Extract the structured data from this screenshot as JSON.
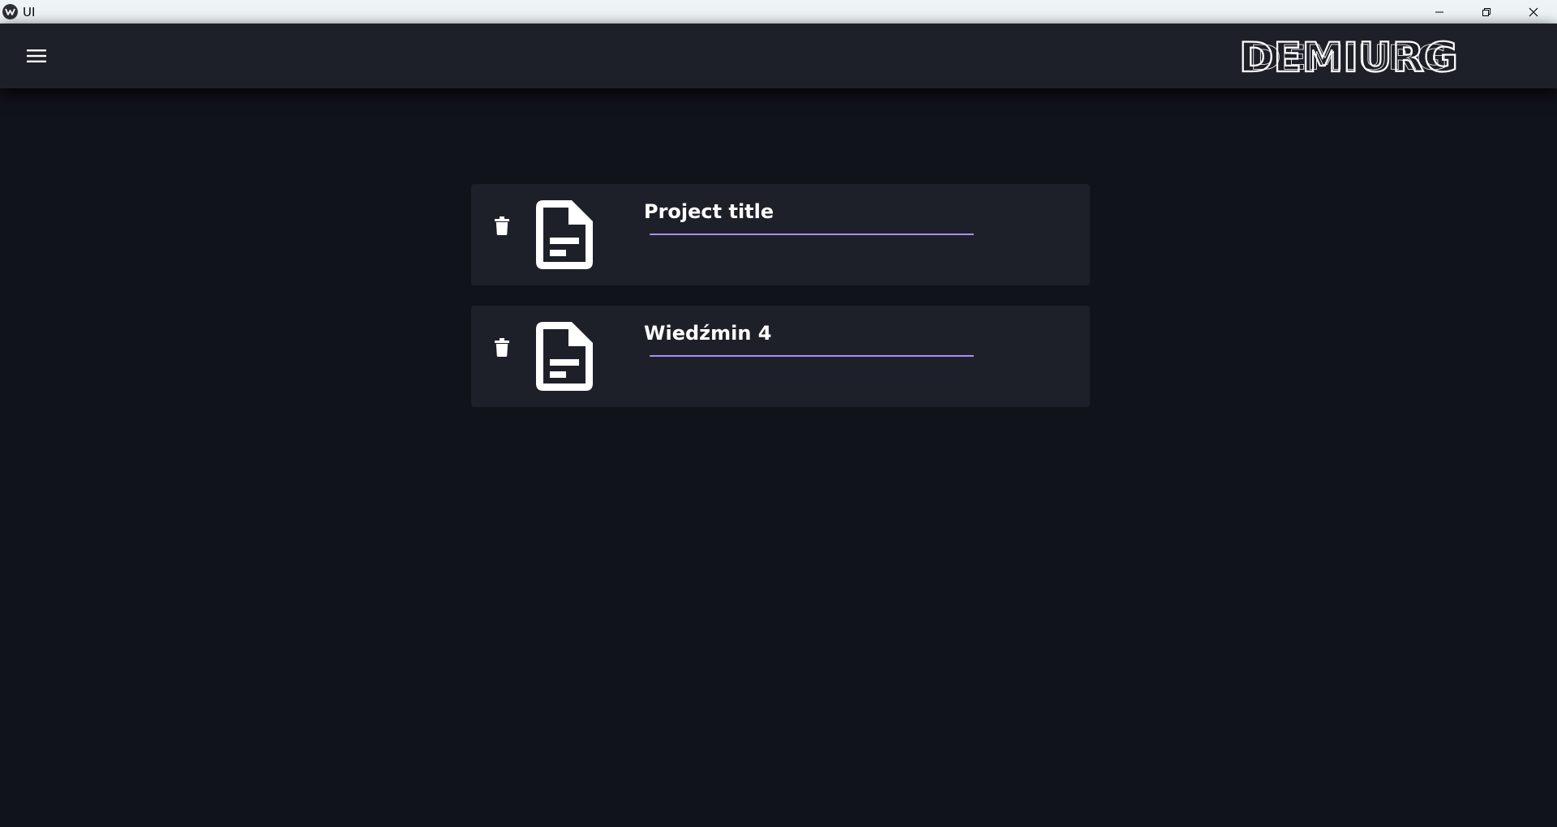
{
  "window": {
    "title": "UI",
    "controls": [
      "minimize-icon",
      "restore-icon",
      "close-icon"
    ]
  },
  "appbar": {
    "menu_icon": "hamburger-menu-icon",
    "logo_text": "DEMIURG"
  },
  "projects": [
    {
      "title": "Project title",
      "icon": "document-icon",
      "delete_icon": "trash-icon"
    },
    {
      "title": "Wiedźmin 4",
      "icon": "document-icon",
      "delete_icon": "trash-icon"
    }
  ],
  "colors": {
    "background": "#11131b",
    "surface": "#1e2029",
    "accent": "#a98ff4",
    "text": "#ffffff"
  }
}
